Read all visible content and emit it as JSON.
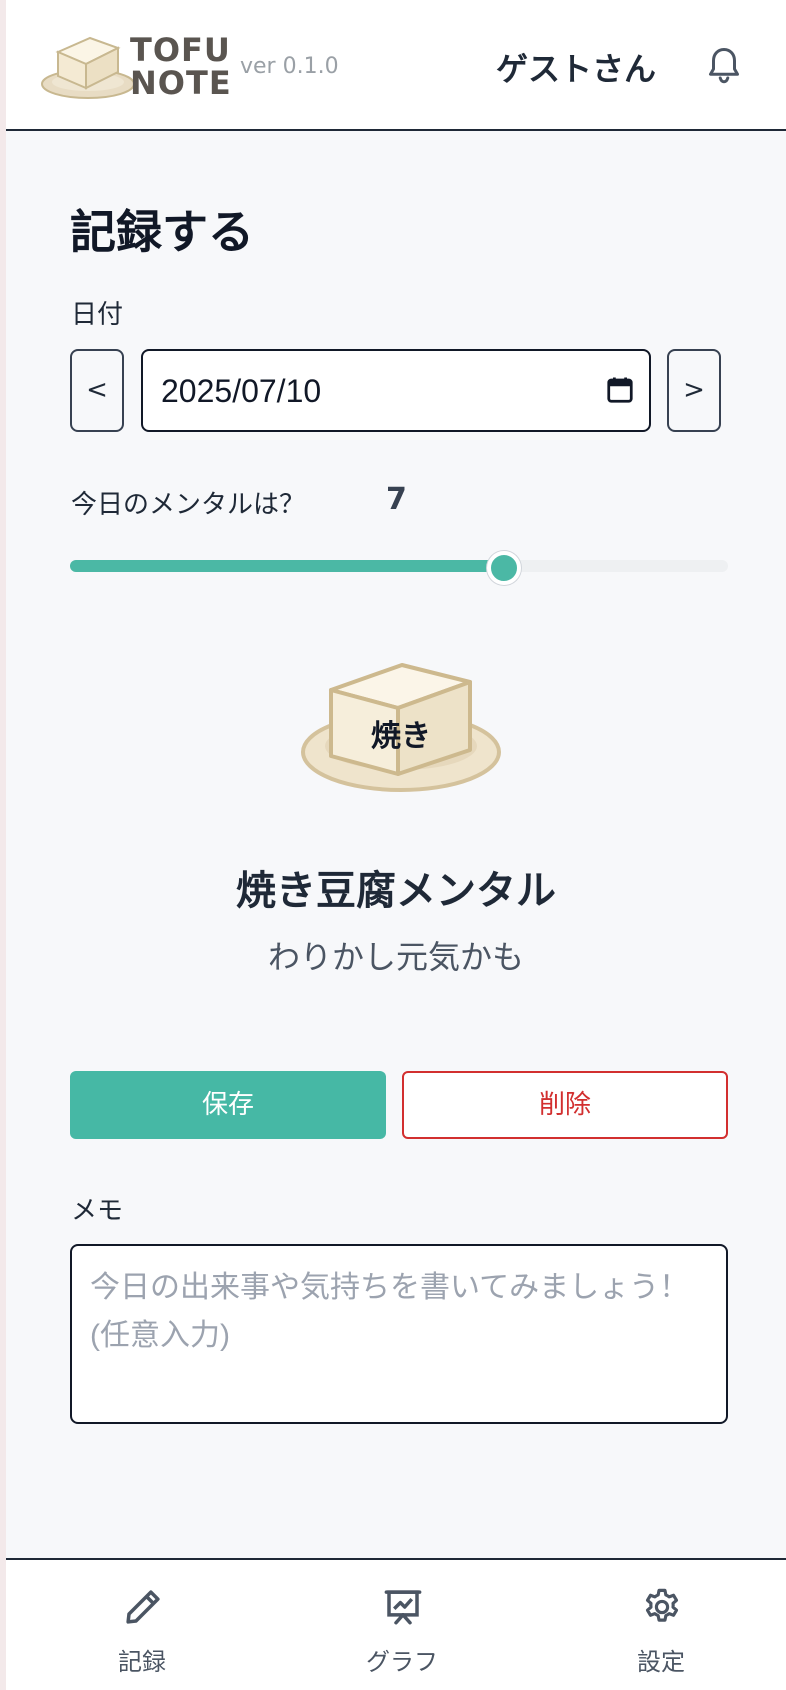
{
  "header": {
    "logo_line1": "TOFU",
    "logo_line2": "NOTE",
    "version": "ver 0.1.0",
    "user_name": "ゲストさん",
    "bell_icon": "bell-icon"
  },
  "main": {
    "title": "記録する",
    "date_label": "日付",
    "prev_label": "<",
    "next_label": ">",
    "date_value": "2025/07/10",
    "calendar_icon": "calendar-icon",
    "mental_label": "今日のメンタルは？",
    "mental_value": "7",
    "slider": {
      "value": 7,
      "min": 1,
      "max": 10,
      "fill_fraction": 0.66
    },
    "tofu_caption": "焼き",
    "mental_type": "焼き豆腐メンタル",
    "mental_desc": "わりかし元気かも",
    "save_label": "保存",
    "delete_label": "削除",
    "memo_label": "メモ",
    "memo_placeholder": "今日の出来事や気持ちを書いてみましょう！(任意入力)",
    "memo_value": ""
  },
  "bottom_nav": {
    "items": [
      {
        "label": "記録",
        "icon": "pencil-icon"
      },
      {
        "label": "グラフ",
        "icon": "chart-board-icon"
      },
      {
        "label": "設定",
        "icon": "gear-icon"
      }
    ]
  },
  "colors": {
    "accent": "#46b8a5",
    "danger": "#d22f2f",
    "text": "#1f2937",
    "background": "#f7f8fa"
  }
}
